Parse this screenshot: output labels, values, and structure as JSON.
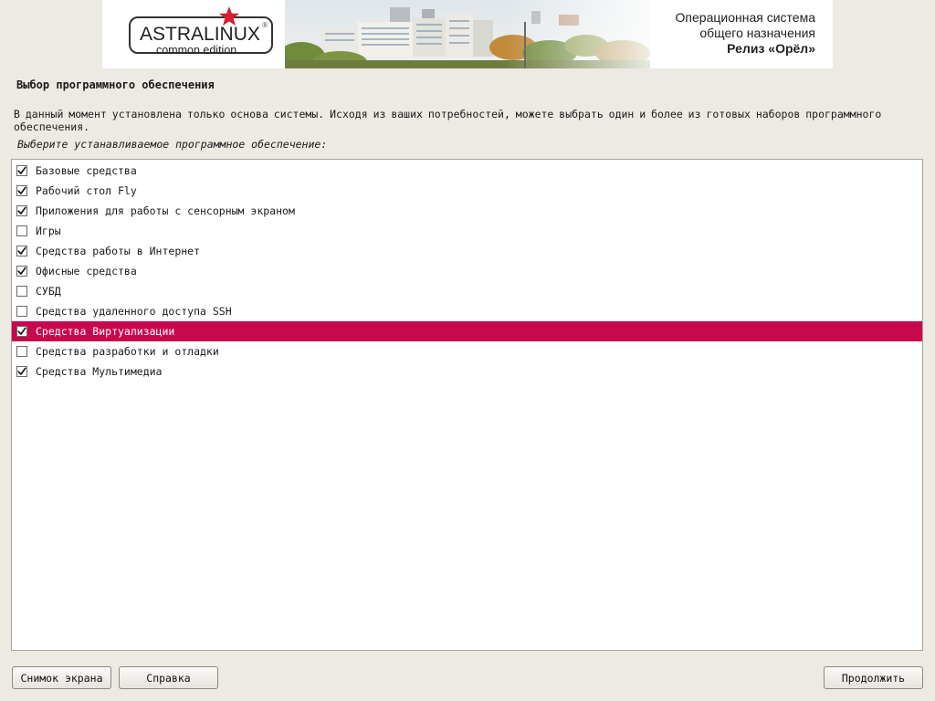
{
  "banner": {
    "logo_text": "ASTRALINUX",
    "logo_registered": "®",
    "logo_edition": "common edition",
    "os_line1": "Операционная система",
    "os_line2": "общего назначения",
    "release": "Релиз «Орёл»"
  },
  "page": {
    "title": "Выбор программного обеспечения",
    "description": "В данный момент установлена только основа системы. Исходя из ваших потребностей, можете выбрать один и более из готовых наборов программного обеспечения.",
    "prompt": "Выберите устанавливаемое программное обеспечение:"
  },
  "software": {
    "items": [
      {
        "label": "Базовые средства",
        "checked": true
      },
      {
        "label": "Рабочий стол Fly",
        "checked": true
      },
      {
        "label": "Приложения для работы с сенсорным экраном",
        "checked": true
      },
      {
        "label": "Игры",
        "checked": false
      },
      {
        "label": "Средства работы в Интернет",
        "checked": true
      },
      {
        "label": "Офисные средства",
        "checked": true
      },
      {
        "label": "СУБД",
        "checked": false
      },
      {
        "label": "Средства удаленного доступа SSH",
        "checked": false
      },
      {
        "label": "Средства Виртуализации",
        "checked": true,
        "selected": true
      },
      {
        "label": "Средства разработки и отладки",
        "checked": false
      },
      {
        "label": "Средства Мультимедиа",
        "checked": true
      }
    ]
  },
  "buttons": {
    "screenshot": "Снимок экрана",
    "help": "Справка",
    "continue": "Продолжить"
  },
  "colors": {
    "background": "#ede9e3",
    "selection": "#c8084c",
    "logo_star": "#d42030"
  }
}
